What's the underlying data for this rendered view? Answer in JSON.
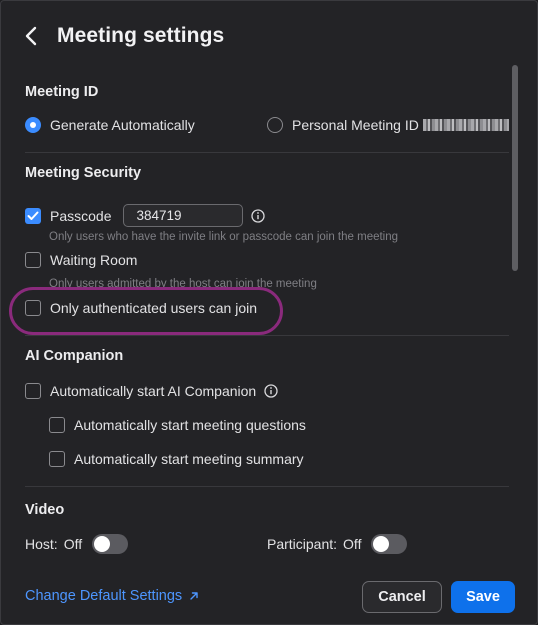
{
  "header": {
    "title": "Meeting settings"
  },
  "meeting_id": {
    "title": "Meeting ID",
    "options": [
      {
        "label": "Generate Automatically",
        "selected": true
      },
      {
        "label": "Personal Meeting ID",
        "selected": false
      }
    ]
  },
  "security": {
    "title": "Meeting Security",
    "passcode_label": "Passcode",
    "passcode_value": "384719",
    "passcode_checked": true,
    "passcode_help": "Only users who have the invite link or passcode can join the meeting",
    "waiting_room_label": "Waiting Room",
    "waiting_room_checked": false,
    "waiting_room_help": "Only users admitted by the host can join the meeting",
    "auth_label": "Only authenticated users can join",
    "auth_checked": false
  },
  "ai": {
    "title": "AI Companion",
    "auto_start_label": "Automatically start AI Companion",
    "questions_label": "Automatically start meeting questions",
    "summary_label": "Automatically start meeting summary"
  },
  "video": {
    "title": "Video",
    "host_label": "Host:",
    "host_state": "Off",
    "participant_label": "Participant:",
    "participant_state": "Off"
  },
  "footer": {
    "change_defaults": "Change Default Settings",
    "cancel": "Cancel",
    "save": "Save"
  },
  "colors": {
    "accent": "#0e71eb",
    "link": "#4d96ff",
    "highlight": "#8a2a7c"
  }
}
